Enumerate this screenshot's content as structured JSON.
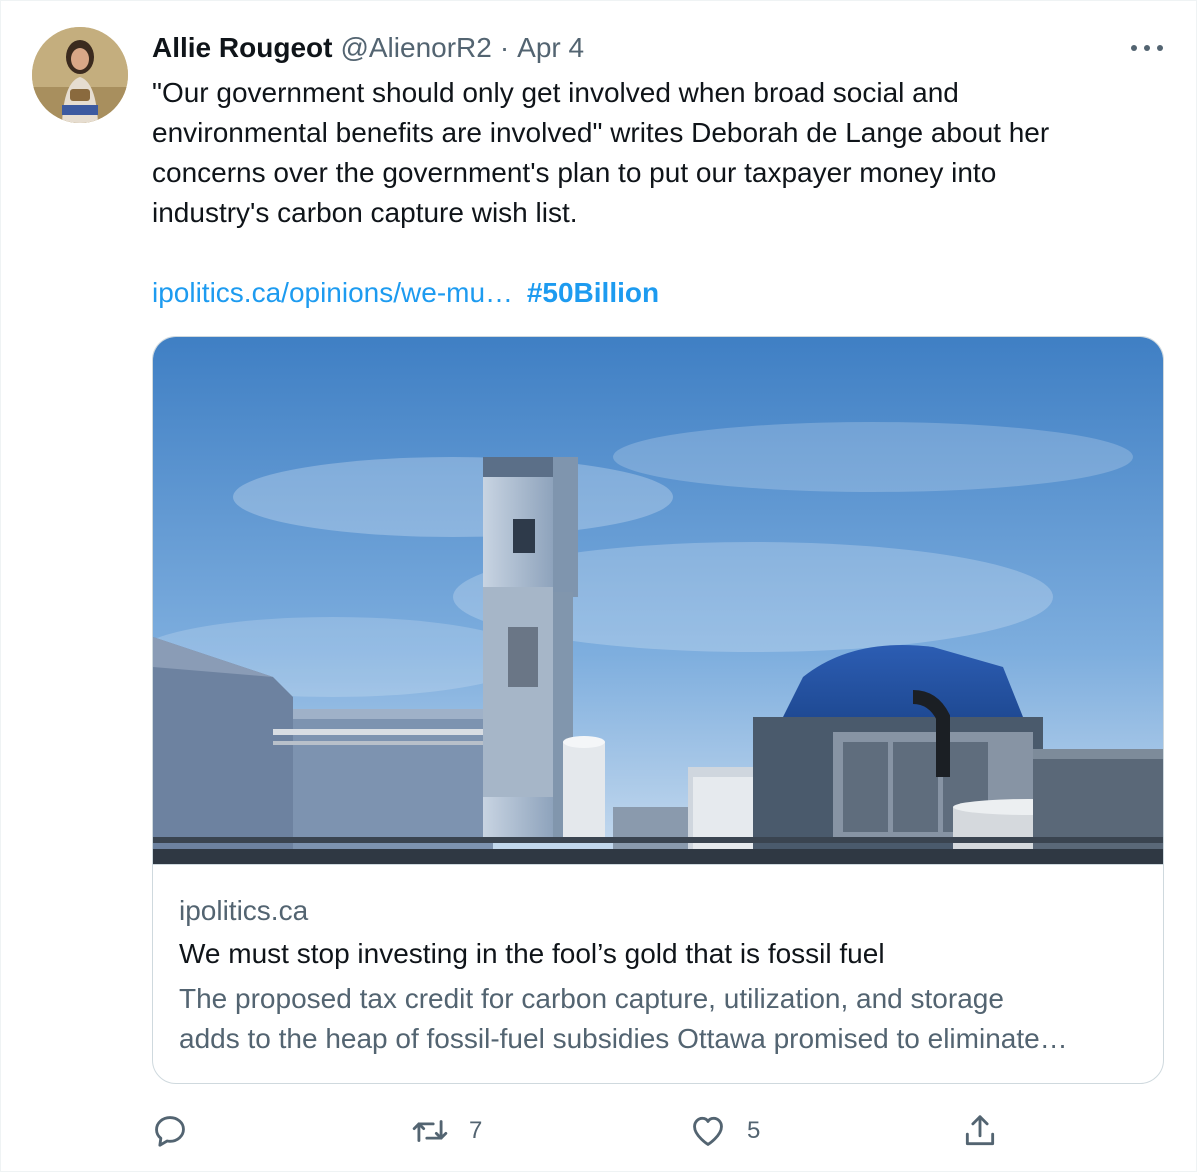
{
  "author": {
    "name": "Allie Rougeot",
    "handle": "@AlienorR2",
    "separator": "·",
    "date": "Apr 4"
  },
  "tweet": {
    "text_lines": [
      "\"Our government should only get involved when broad social and",
      "environmental benefits are involved\" writes Deborah de Lange about her",
      "concerns over the government's plan to put our taxpayer money into",
      "industry's carbon capture wish list."
    ],
    "link_text": "ipolitics.ca/opinions/we-mu…",
    "hashtag": "#50Billion"
  },
  "card": {
    "domain": "ipolitics.ca",
    "title": "We must stop investing in the fool’s gold that is fossil fuel",
    "description_lines": [
      "The proposed tax credit for carbon capture, utilization, and storage",
      "adds to the heap of fossil-fuel subsidies Ottawa promised to eliminate…"
    ]
  },
  "actions": {
    "reply_icon": "reply-icon",
    "retweet_icon": "retweet-icon",
    "retweet_count": "7",
    "like_icon": "heart-icon",
    "like_count": "5",
    "share_icon": "share-icon"
  },
  "colors": {
    "accent": "#1d9bf0",
    "secondary_text": "#536471",
    "primary_text": "#0f1419",
    "border": "#cfd9de"
  }
}
